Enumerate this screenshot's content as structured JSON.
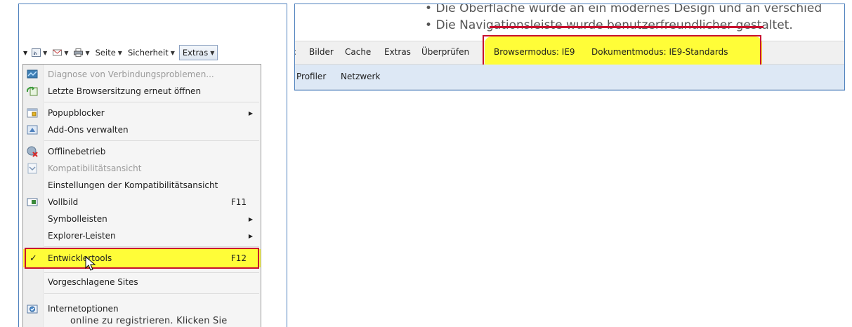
{
  "left": {
    "cmdbar": {
      "seite_label": "Seite",
      "sicherheit_label": "Sicherheit",
      "extras_label": "Extras",
      "dropdown_glyph": "▼"
    },
    "menu": {
      "items": [
        {
          "label": "Diagnose von Verbindungsproblemen...",
          "icon": "network-diagnose-icon",
          "disabled": true
        },
        {
          "label": "Letzte Browsersitzung erneut öffnen",
          "icon": "reopen-session-icon",
          "disabled": false
        },
        {
          "label": "Popupblocker",
          "icon": "popup-blocker-icon",
          "submenu": true
        },
        {
          "label": "Add-Ons verwalten",
          "icon": "addons-icon"
        },
        {
          "label": "Offlinebetrieb",
          "icon": "offline-icon"
        },
        {
          "label": "Kompatibilitätsansicht",
          "icon": "compatibility-icon",
          "disabled": true
        },
        {
          "label": "Einstellungen der Kompatibilitätsansicht"
        },
        {
          "label": "Vollbild",
          "icon": "fullscreen-icon",
          "shortcut": "F11"
        },
        {
          "label": "Symbolleisten",
          "submenu": true
        },
        {
          "label": "Explorer-Leisten",
          "submenu": true
        },
        {
          "label": "Entwicklertools",
          "shortcut": "F12",
          "checked": true,
          "highlight_color": "#fffd38"
        },
        {
          "label": "Vorgeschlagene Sites"
        },
        {
          "label": "Internetoptionen",
          "icon": "internet-options-icon"
        }
      ],
      "check_glyph": "✓",
      "submenu_glyph": "▶"
    },
    "bottom_text": "online zu registrieren. Klicken Sie"
  },
  "right": {
    "bullets": [
      "Die Oberfläche wurde an ein modernes Design und an verschied",
      "Die Navigationsleiste wurde benutzerfreundlicher gestaltet."
    ],
    "bullet_glyph": "•",
    "devbar": {
      "items": [
        "Bilder",
        "Cache",
        "Extras",
        "Überprüfen"
      ],
      "browser_mode": "Browsermodus: IE9",
      "document_mode": "Dokumentmodus: IE9-Standards"
    },
    "tabs": [
      "Profiler",
      "Netzwerk"
    ]
  },
  "colors": {
    "highlight_yellow": "#fffd38",
    "annotation_red": "#c8102e",
    "frame_blue": "#4f81bd"
  }
}
